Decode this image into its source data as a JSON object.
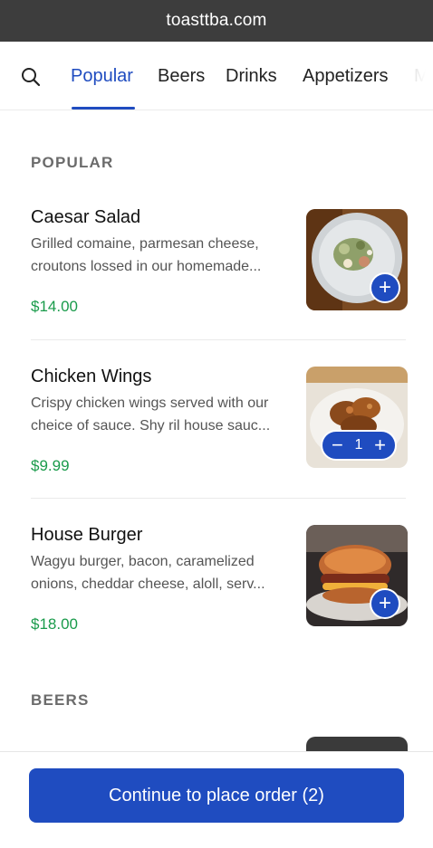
{
  "browser": {
    "url": "toasttba.com"
  },
  "nav": {
    "tabs": [
      {
        "label": "Popular",
        "active": true
      },
      {
        "label": "Beers"
      },
      {
        "label": "Drinks"
      },
      {
        "label": "Appetizers"
      },
      {
        "label": "Me"
      }
    ]
  },
  "sections": {
    "popular": "POPULAR",
    "beers": "BEERS"
  },
  "items": [
    {
      "name": "Caesar Salad",
      "description": "Grilled comaine, parmesan cheese, croutons lossed in our homemade...",
      "price": "$14.00",
      "control": "add"
    },
    {
      "name": "Chicken Wings",
      "description": "Crispy chicken wings served with our cheice of sauce. Shy ril house sauc...",
      "price": "$9.99",
      "control": "stepper",
      "quantity": "1"
    },
    {
      "name": "House Burger",
      "description": "Wagyu burger, bacon, caramelized onions, cheddar cheese, aloll, serv...",
      "price": "$18.00",
      "control": "add"
    }
  ],
  "icons": {
    "search": "search-icon",
    "add": "plus-icon",
    "decrement": "minus-icon",
    "increment": "plus-icon"
  },
  "colors": {
    "accent": "#1f4cc0",
    "price": "#1a9b4b",
    "url_bar": "#3d3d3d"
  },
  "cta": {
    "label": "Continue to place order (2)"
  },
  "glyphs": {
    "plus": "+",
    "minus": "−"
  }
}
